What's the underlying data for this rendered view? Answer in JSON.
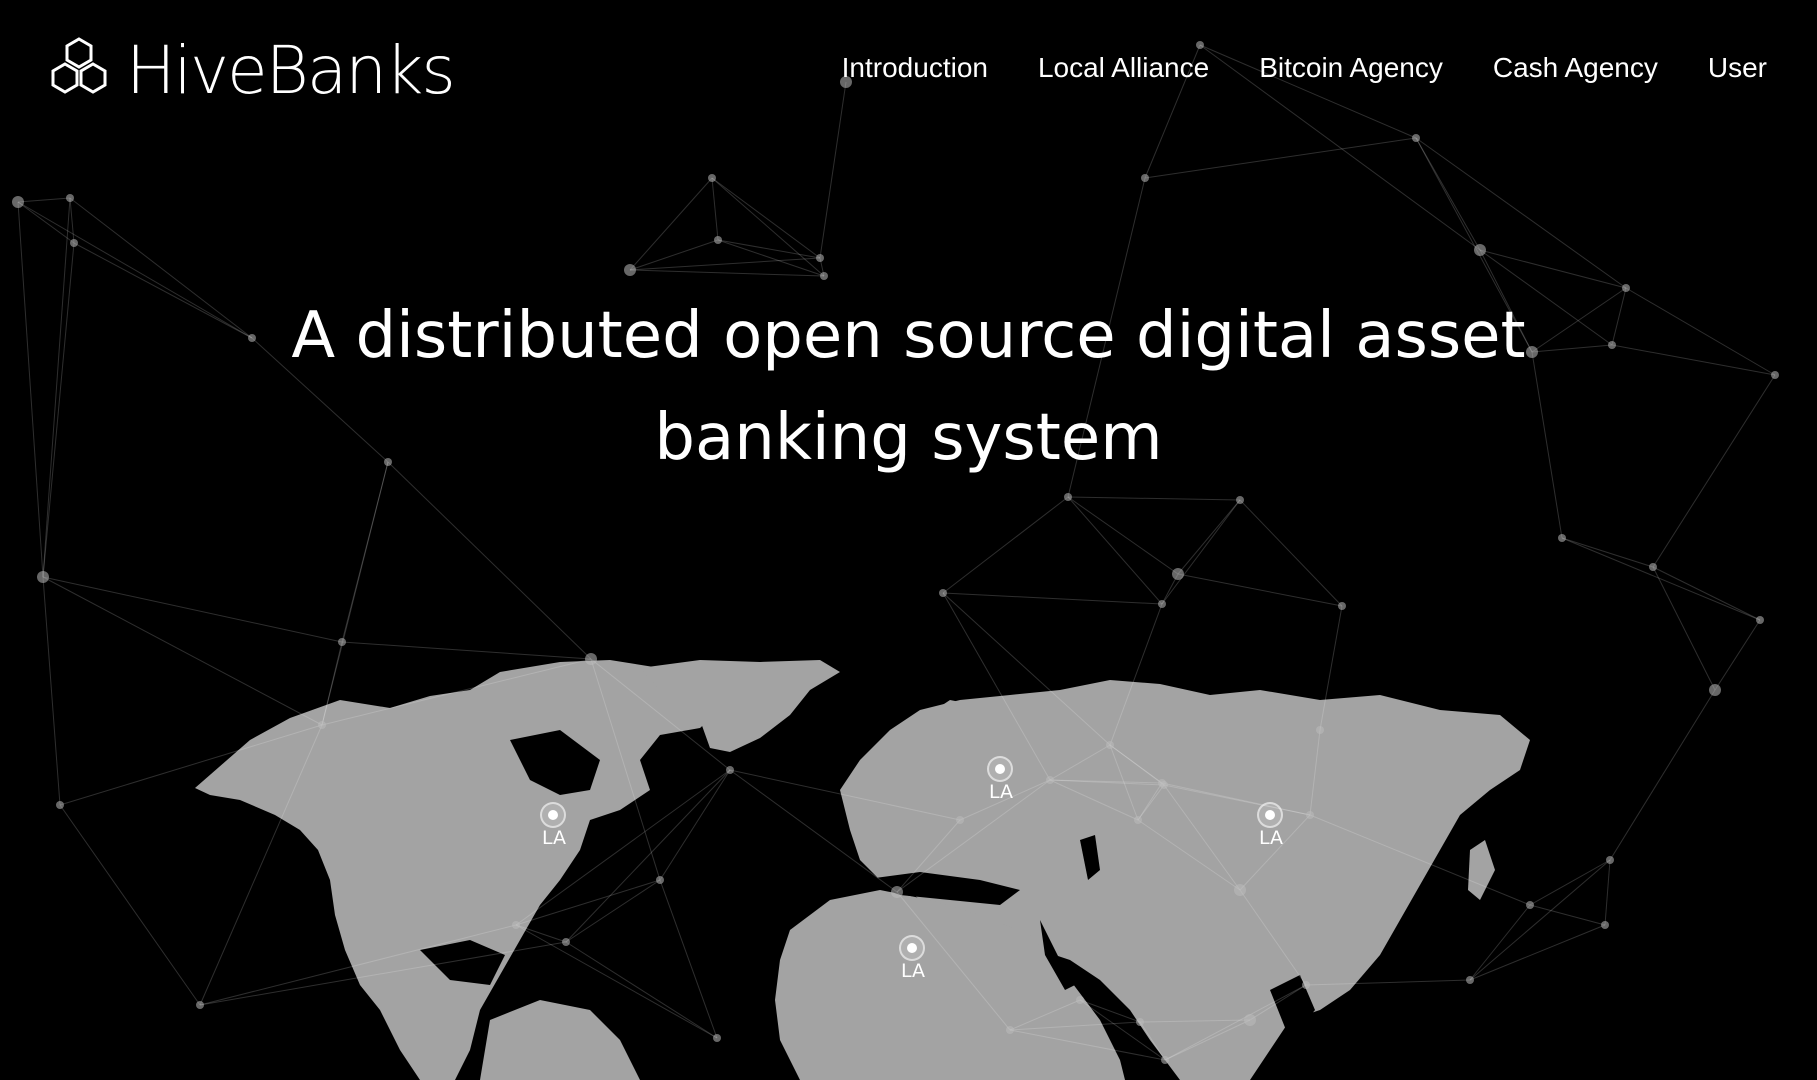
{
  "brand": {
    "name": "HiveBanks",
    "logo_icon": "hexagon-cluster-icon"
  },
  "nav": {
    "items": [
      {
        "label": "Introduction"
      },
      {
        "label": "Local Alliance"
      },
      {
        "label": "Bitcoin Agency"
      },
      {
        "label": "Cash Agency"
      },
      {
        "label": "User"
      }
    ]
  },
  "hero": {
    "line1": "A distributed open source digital asset",
    "line2": "banking system"
  },
  "map": {
    "pins": [
      {
        "label": "LA"
      },
      {
        "label": "LA"
      },
      {
        "label": "LA"
      },
      {
        "label": "LA"
      }
    ]
  },
  "colors": {
    "background": "#000000",
    "land": "#a6a6a6",
    "network": "#ffffff"
  }
}
